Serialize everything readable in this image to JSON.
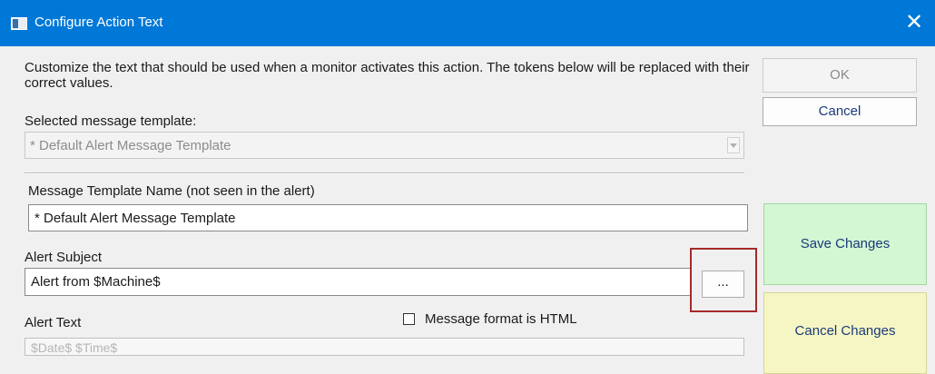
{
  "window": {
    "title": "Configure Action Text",
    "close_glyph": "✕"
  },
  "intro_text": "Customize the text that should be used when a monitor activates this action.  The tokens below will be replaced with their correct values.",
  "template_selector": {
    "label": "Selected message template:",
    "value": "* Default Alert Message Template"
  },
  "template_name": {
    "label": "Message Template Name (not seen in the alert)",
    "value": "* Default Alert Message Template"
  },
  "alert_subject": {
    "label": "Alert Subject",
    "value": "Alert from $Machine$",
    "ellipsis_label": "..."
  },
  "alert_text": {
    "label": "Alert Text",
    "value": "$Date$  $Time$",
    "html_checkbox_label": "Message format is HTML",
    "html_checked": false
  },
  "buttons": {
    "ok": "OK",
    "cancel": "Cancel",
    "save_changes": "Save Changes",
    "cancel_changes": "Cancel Changes"
  },
  "colors": {
    "titlebar": "#0078d7",
    "save_button_bg": "#d2f7d2",
    "cancel_changes_bg": "#f6f6c4",
    "highlight_border": "#a52a2a"
  },
  "icons": {
    "window_icon": "window-icon",
    "close": "close-icon",
    "dropdown": "chevron-down-icon"
  }
}
